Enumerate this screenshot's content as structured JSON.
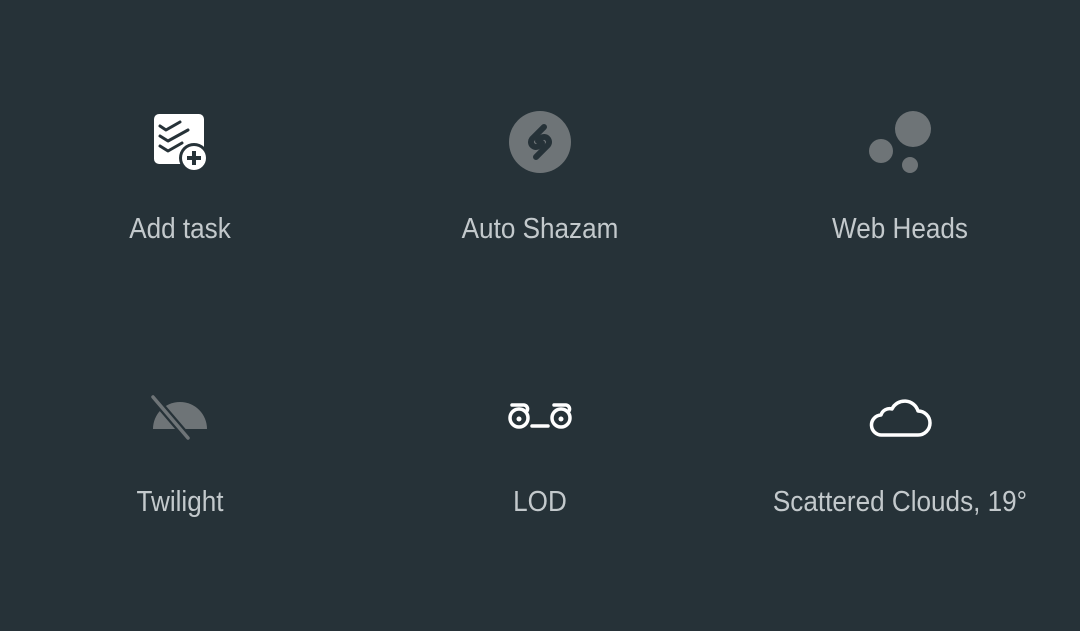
{
  "tiles": [
    {
      "label": "Add task",
      "icon": "add-task-icon",
      "state": "active"
    },
    {
      "label": "Auto Shazam",
      "icon": "shazam-icon",
      "state": "inactive"
    },
    {
      "label": "Web Heads",
      "icon": "web-heads-icon",
      "state": "inactive"
    },
    {
      "label": "Twilight",
      "icon": "twilight-off-icon",
      "state": "inactive"
    },
    {
      "label": "LOD",
      "icon": "lod-face-icon",
      "state": "active"
    },
    {
      "label": "Scattered Clouds, 19°",
      "icon": "cloud-icon",
      "state": "active"
    }
  ],
  "colors": {
    "background": "#263238",
    "label": "#c3c9cc",
    "icon_active": "#ffffff",
    "icon_inactive": "#6e7477"
  }
}
